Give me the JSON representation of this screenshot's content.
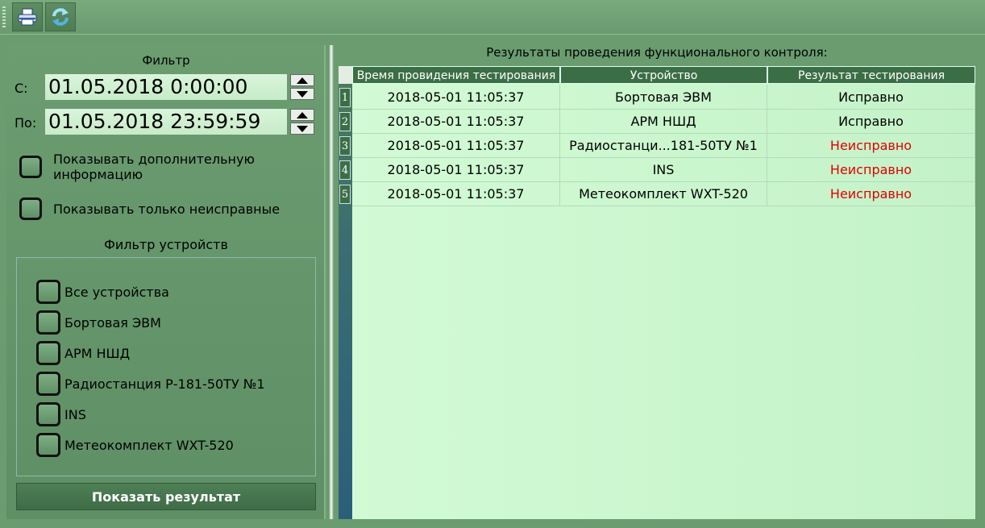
{
  "toolbar": {
    "print_icon": "printer-icon",
    "refresh_icon": "refresh-icon"
  },
  "filter": {
    "title": "Фильтр",
    "from_label": "С:",
    "from_value": "01.05.2018 0:00:00",
    "to_label": "По:",
    "to_value": "01.05.2018 23:59:59",
    "show_extra_label": "Показывать дополнительную информацию",
    "show_faulty_label": "Показывать только неисправные"
  },
  "device_filter": {
    "title": "Фильтр устройств",
    "items": [
      "Все устройства",
      "Бортовая ЭВМ",
      "АРМ НШД",
      "Радиостанция Р-181-50ТУ №1",
      "INS",
      "Метеокомплект WXT-520"
    ]
  },
  "show_button": "Показать результат",
  "results": {
    "title": "Результаты проведения функционального контроля:",
    "columns": [
      "Время провидения тестирования",
      "Устройство",
      "Результат тестирования"
    ],
    "rows": [
      {
        "n": "1",
        "time": "2018-05-01 11:05:37",
        "device": "Бортовая ЭВМ",
        "result": "Исправно",
        "status": "ok"
      },
      {
        "n": "2",
        "time": "2018-05-01 11:05:37",
        "device": "АРМ НШД",
        "result": "Исправно",
        "status": "ok"
      },
      {
        "n": "3",
        "time": "2018-05-01 11:05:37",
        "device": "Радиостанци...181-50ТУ №1",
        "result": "Неисправно",
        "status": "bad"
      },
      {
        "n": "4",
        "time": "2018-05-01 11:05:37",
        "device": "INS",
        "result": "Неисправно",
        "status": "bad"
      },
      {
        "n": "5",
        "time": "2018-05-01 11:05:37",
        "device": "Метеокомплект WXT-520",
        "result": "Неисправно",
        "status": "bad"
      }
    ]
  },
  "colors": {
    "ok": "#000000",
    "fault": "#e00000",
    "header_bg": "#3c6e46",
    "grid_bg": "#d2fbd5"
  }
}
